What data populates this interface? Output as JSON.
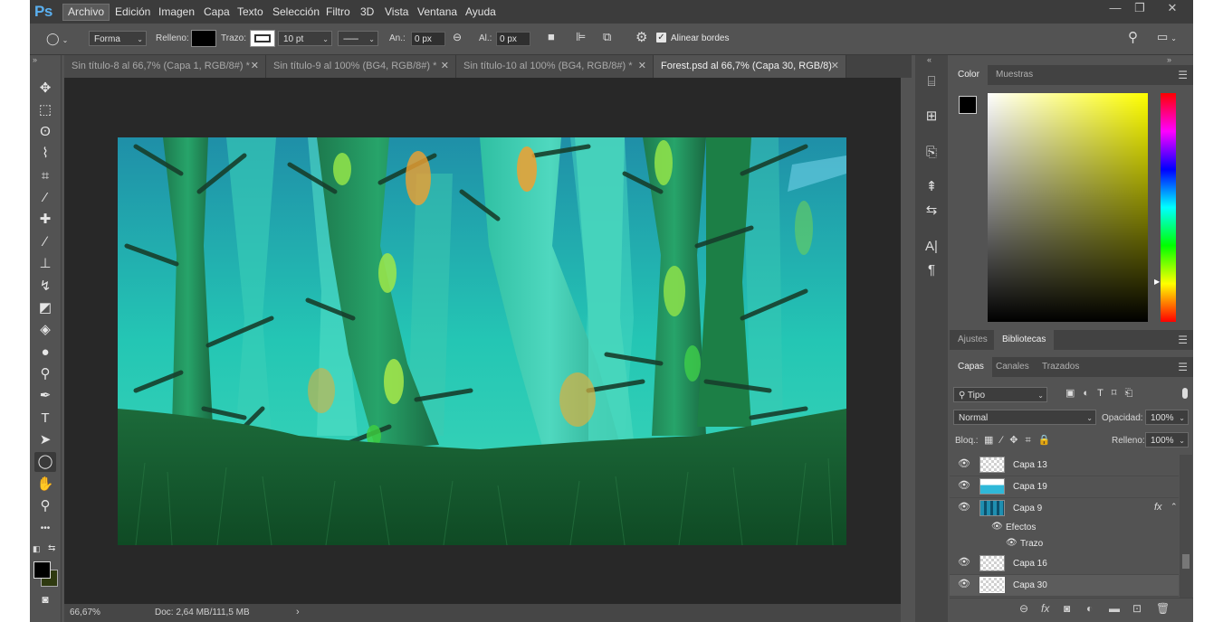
{
  "app": {
    "logo": "Ps"
  },
  "menu": [
    "Archivo",
    "Edición",
    "Imagen",
    "Capa",
    "Texto",
    "Selección",
    "Filtro",
    "3D",
    "Vista",
    "Ventana",
    "Ayuda"
  ],
  "window_controls": {
    "minimize": "—",
    "restore": "❐",
    "close": "✕"
  },
  "options": {
    "mode_value": "Forma",
    "fill_label": "Relleno:",
    "stroke_label": "Trazo:",
    "stroke_width": "10 pt",
    "width_label": "An.:",
    "width_value": "0 px",
    "height_label": "Al.:",
    "height_value": "0 px",
    "align_edges_label": "Alinear bordes",
    "align_edges_checked": true,
    "fill_color": "#000000",
    "stroke_color": "#ffffff"
  },
  "tabs": [
    {
      "label": "Sin título-8 al 66,7% (Capa 1, RGB/8#) *",
      "close": "✕",
      "active": false
    },
    {
      "label": "Sin título-9 al 100% (BG4, RGB/8#) *",
      "close": "✕",
      "active": false
    },
    {
      "label": "Sin título-10 al 100% (BG4, RGB/8#) *",
      "close": "✕",
      "active": false
    },
    {
      "label": "Forest.psd al 66,7% (Capa 30, RGB/8)",
      "close": "✕",
      "active": true
    }
  ],
  "tools": [
    {
      "icon": "move-icon",
      "glyph": "✥"
    },
    {
      "icon": "marquee-icon",
      "glyph": "⬚"
    },
    {
      "icon": "lasso-icon",
      "glyph": "ʘ"
    },
    {
      "icon": "quick-select-icon",
      "glyph": "⌇"
    },
    {
      "icon": "crop-icon",
      "glyph": "⌗"
    },
    {
      "icon": "eyedropper-icon",
      "glyph": "⁄"
    },
    {
      "icon": "healing-brush-icon",
      "glyph": "✚"
    },
    {
      "icon": "brush-icon",
      "glyph": "∕"
    },
    {
      "icon": "clone-stamp-icon",
      "glyph": "⊥"
    },
    {
      "icon": "history-brush-icon",
      "glyph": "↯"
    },
    {
      "icon": "eraser-icon",
      "glyph": "◩"
    },
    {
      "icon": "paint-bucket-icon",
      "glyph": "◈"
    },
    {
      "icon": "blur-icon",
      "glyph": "●"
    },
    {
      "icon": "dodge-icon",
      "glyph": "⚲"
    },
    {
      "icon": "pen-icon",
      "glyph": "✒"
    },
    {
      "icon": "type-icon",
      "glyph": "T"
    },
    {
      "icon": "path-select-icon",
      "glyph": "➤"
    },
    {
      "icon": "ellipse-icon",
      "glyph": "◯"
    },
    {
      "icon": "hand-icon",
      "glyph": "✋"
    },
    {
      "icon": "zoom-icon",
      "glyph": "⚲"
    },
    {
      "icon": "more-tools-icon",
      "glyph": "•••"
    }
  ],
  "colors": {
    "foreground": "#000000",
    "background": "#2f3a10",
    "accent_selected": "#3a3a3a"
  },
  "status": {
    "zoom": "66,67%",
    "doc": "Doc: 2,64 MB/111,5 MB",
    "arrow": "›"
  },
  "color_panel": {
    "tab_color": "Color",
    "tab_swatches": "Muestras",
    "hue": "#ffff00"
  },
  "adjust_panel": {
    "tab_adjustments": "Ajustes",
    "tab_libraries": "Bibliotecas"
  },
  "layers_panel": {
    "tab_layers": "Capas",
    "tab_channels": "Canales",
    "tab_paths": "Trazados",
    "filter_value": "Tipo",
    "blend_mode": "Normal",
    "opacity_label": "Opacidad:",
    "opacity_value": "100%",
    "lock_label": "Bloq.:",
    "fill_label": "Relleno:",
    "fill_value": "100%",
    "effects_label": "Efectos",
    "stroke_effect_label": "Trazo",
    "fx_label": "fx",
    "layers": [
      {
        "name": "Capa 13",
        "thumb": "checker",
        "selected": false
      },
      {
        "name": "Capa 19",
        "thumb": "sky",
        "selected": false
      },
      {
        "name": "Capa 9",
        "thumb": "trees",
        "selected": false,
        "has_fx": true
      },
      {
        "name": "Capa 16",
        "thumb": "checker",
        "selected": false
      },
      {
        "name": "Capa 30",
        "thumb": "checker",
        "selected": true
      }
    ]
  }
}
